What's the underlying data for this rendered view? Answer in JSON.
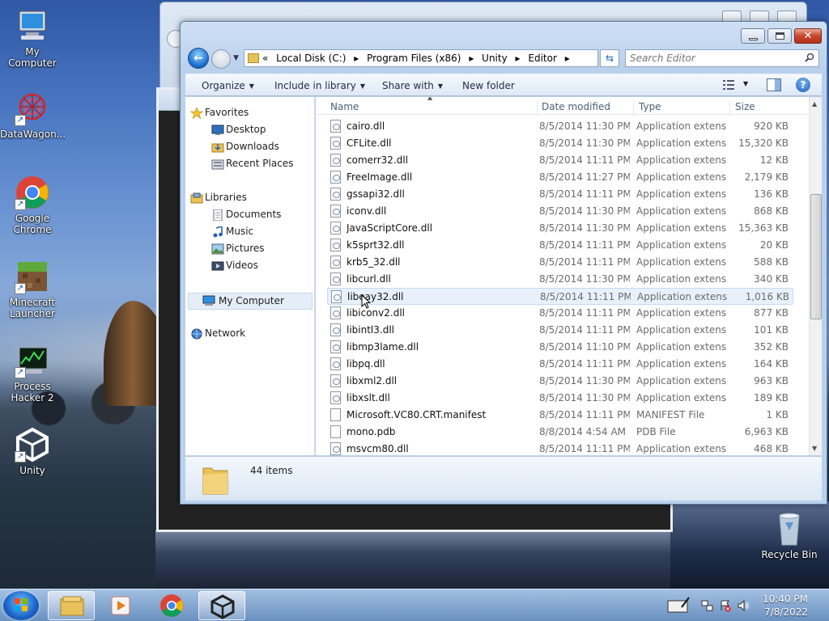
{
  "desktop": {
    "icons": [
      {
        "label": "My Computer",
        "shortcut": false
      },
      {
        "label": "DataWagon...",
        "shortcut": true
      },
      {
        "label": "Google Chrome",
        "shortcut": true
      },
      {
        "label": "Minecraft Launcher",
        "shortcut": true
      },
      {
        "label": "Process Hacker 2",
        "shortcut": true
      },
      {
        "label": "Unity",
        "shortcut": true
      }
    ],
    "recycle_bin": "Recycle Bin"
  },
  "explorer": {
    "address": {
      "crumbs": [
        "«",
        "Local Disk (C:)",
        "▸",
        "Program Files (x86)",
        "▸",
        "Unity",
        "▸",
        "Editor",
        "▸"
      ]
    },
    "search": {
      "placeholder": "Search Editor"
    },
    "toolbar": {
      "organize": "Organize",
      "include_in_library": "Include in library",
      "share_with": "Share with",
      "new_folder": "New folder"
    },
    "nav": {
      "favorites": "Favorites",
      "desktop": "Desktop",
      "downloads": "Downloads",
      "recent_places": "Recent Places",
      "libraries": "Libraries",
      "documents": "Documents",
      "music": "Music",
      "pictures": "Pictures",
      "videos": "Videos",
      "my_computer": "My Computer",
      "network": "Network"
    },
    "columns": {
      "name": "Name",
      "date": "Date modified",
      "type": "Type",
      "size": "Size"
    },
    "files": [
      {
        "name": "cairo.dll",
        "date": "8/5/2014 11:30 PM",
        "type": "Application extens...",
        "size": "920 KB"
      },
      {
        "name": "CFLite.dll",
        "date": "8/5/2014 11:30 PM",
        "type": "Application extens...",
        "size": "15,320 KB"
      },
      {
        "name": "comerr32.dll",
        "date": "8/5/2014 11:11 PM",
        "type": "Application extens...",
        "size": "12 KB"
      },
      {
        "name": "FreeImage.dll",
        "date": "8/5/2014 11:27 PM",
        "type": "Application extens...",
        "size": "2,179 KB"
      },
      {
        "name": "gssapi32.dll",
        "date": "8/5/2014 11:11 PM",
        "type": "Application extens...",
        "size": "136 KB"
      },
      {
        "name": "iconv.dll",
        "date": "8/5/2014 11:30 PM",
        "type": "Application extens...",
        "size": "868 KB"
      },
      {
        "name": "JavaScriptCore.dll",
        "date": "8/5/2014 11:30 PM",
        "type": "Application extens...",
        "size": "15,363 KB"
      },
      {
        "name": "k5sprt32.dll",
        "date": "8/5/2014 11:11 PM",
        "type": "Application extens...",
        "size": "20 KB"
      },
      {
        "name": "krb5_32.dll",
        "date": "8/5/2014 11:11 PM",
        "type": "Application extens...",
        "size": "588 KB"
      },
      {
        "name": "libcurl.dll",
        "date": "8/5/2014 11:30 PM",
        "type": "Application extens...",
        "size": "340 KB"
      },
      {
        "name": "libeay32.dll",
        "date": "8/5/2014 11:11 PM",
        "type": "Application extens...",
        "size": "1,016 KB"
      },
      {
        "name": "libiconv2.dll",
        "date": "8/5/2014 11:11 PM",
        "type": "Application extens...",
        "size": "877 KB"
      },
      {
        "name": "libintl3.dll",
        "date": "8/5/2014 11:11 PM",
        "type": "Application extens...",
        "size": "101 KB"
      },
      {
        "name": "libmp3lame.dll",
        "date": "8/5/2014 11:10 PM",
        "type": "Application extens...",
        "size": "352 KB"
      },
      {
        "name": "libpq.dll",
        "date": "8/5/2014 11:11 PM",
        "type": "Application extens...",
        "size": "164 KB"
      },
      {
        "name": "libxml2.dll",
        "date": "8/5/2014 11:30 PM",
        "type": "Application extens...",
        "size": "963 KB"
      },
      {
        "name": "libxslt.dll",
        "date": "8/5/2014 11:30 PM",
        "type": "Application extens...",
        "size": "189 KB"
      },
      {
        "name": "Microsoft.VC80.CRT.manifest",
        "date": "8/5/2014 11:11 PM",
        "type": "MANIFEST File",
        "size": "1 KB"
      },
      {
        "name": "mono.pdb",
        "date": "8/8/2014 4:54 AM",
        "type": "PDB File",
        "size": "6,963 KB"
      },
      {
        "name": "msvcm80.dll",
        "date": "8/5/2014 11:11 PM",
        "type": "Application extens...",
        "size": "468 KB"
      }
    ],
    "status": {
      "items": "44 items"
    }
  },
  "taskbar": {
    "time": "10:40 PM",
    "date": "7/8/2022"
  },
  "colors": {
    "accent": "#1e6fcf",
    "close": "#c8462c",
    "hover_row": "#e8f1fb"
  }
}
